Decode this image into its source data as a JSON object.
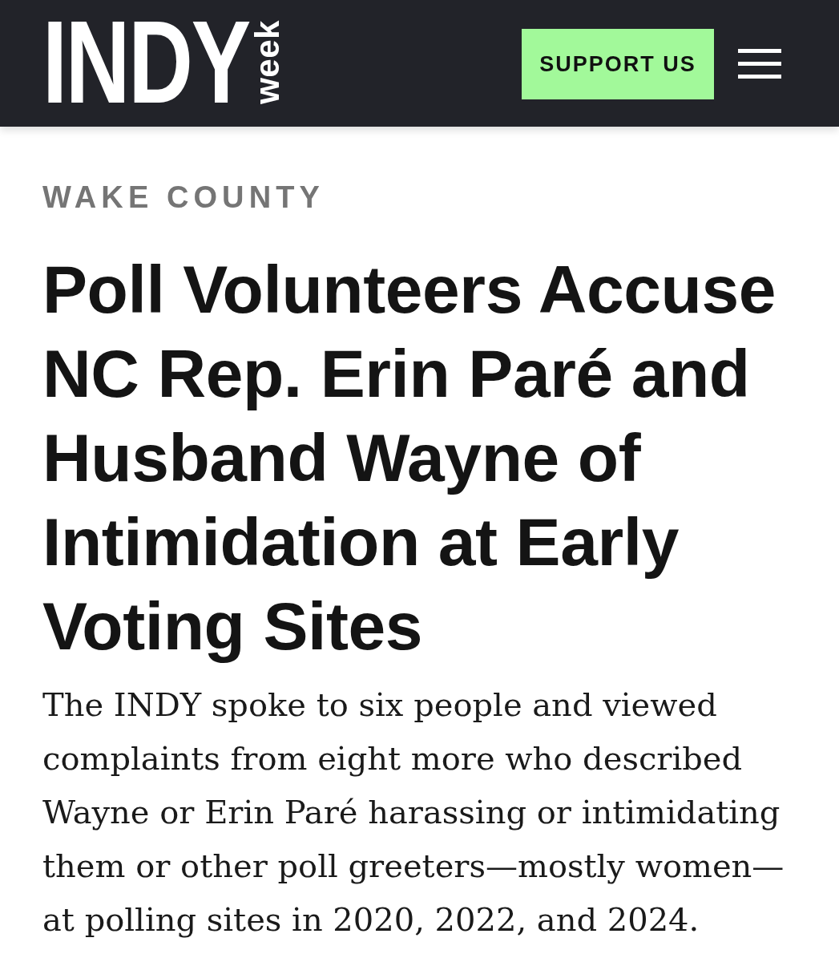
{
  "header": {
    "logo": {
      "wordmark": "INDY",
      "tagline": "week"
    },
    "support_button": {
      "label": "SUPPORT US"
    }
  },
  "article": {
    "section": "WAKE COUNTY",
    "headline": "Poll Volunteers Accuse NC Rep. Erin Paré and Husband Wayne of Intimidation at Early Voting Sites",
    "summary": "The INDY spoke to six people and viewed complaints from eight more who described Wayne or Erin Paré harassing or intimidating them or other poll greeters—mostly women—at polling sites in 2020, 2022, and 2024."
  }
}
